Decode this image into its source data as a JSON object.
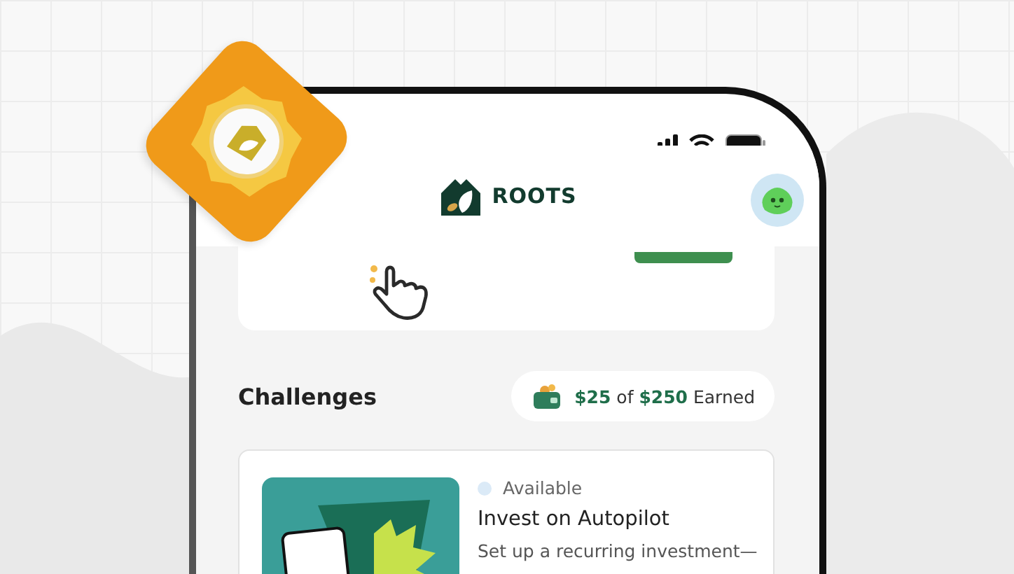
{
  "header": {
    "logo_text": "ROOTS"
  },
  "challenges": {
    "title": "Challenges",
    "earned": "**$25** of **$250** Earned"
  },
  "cards": [
    {
      "status": "Available",
      "title": "Invest on Autopilot",
      "description": "Set up a recurring investment—"
    }
  ]
}
